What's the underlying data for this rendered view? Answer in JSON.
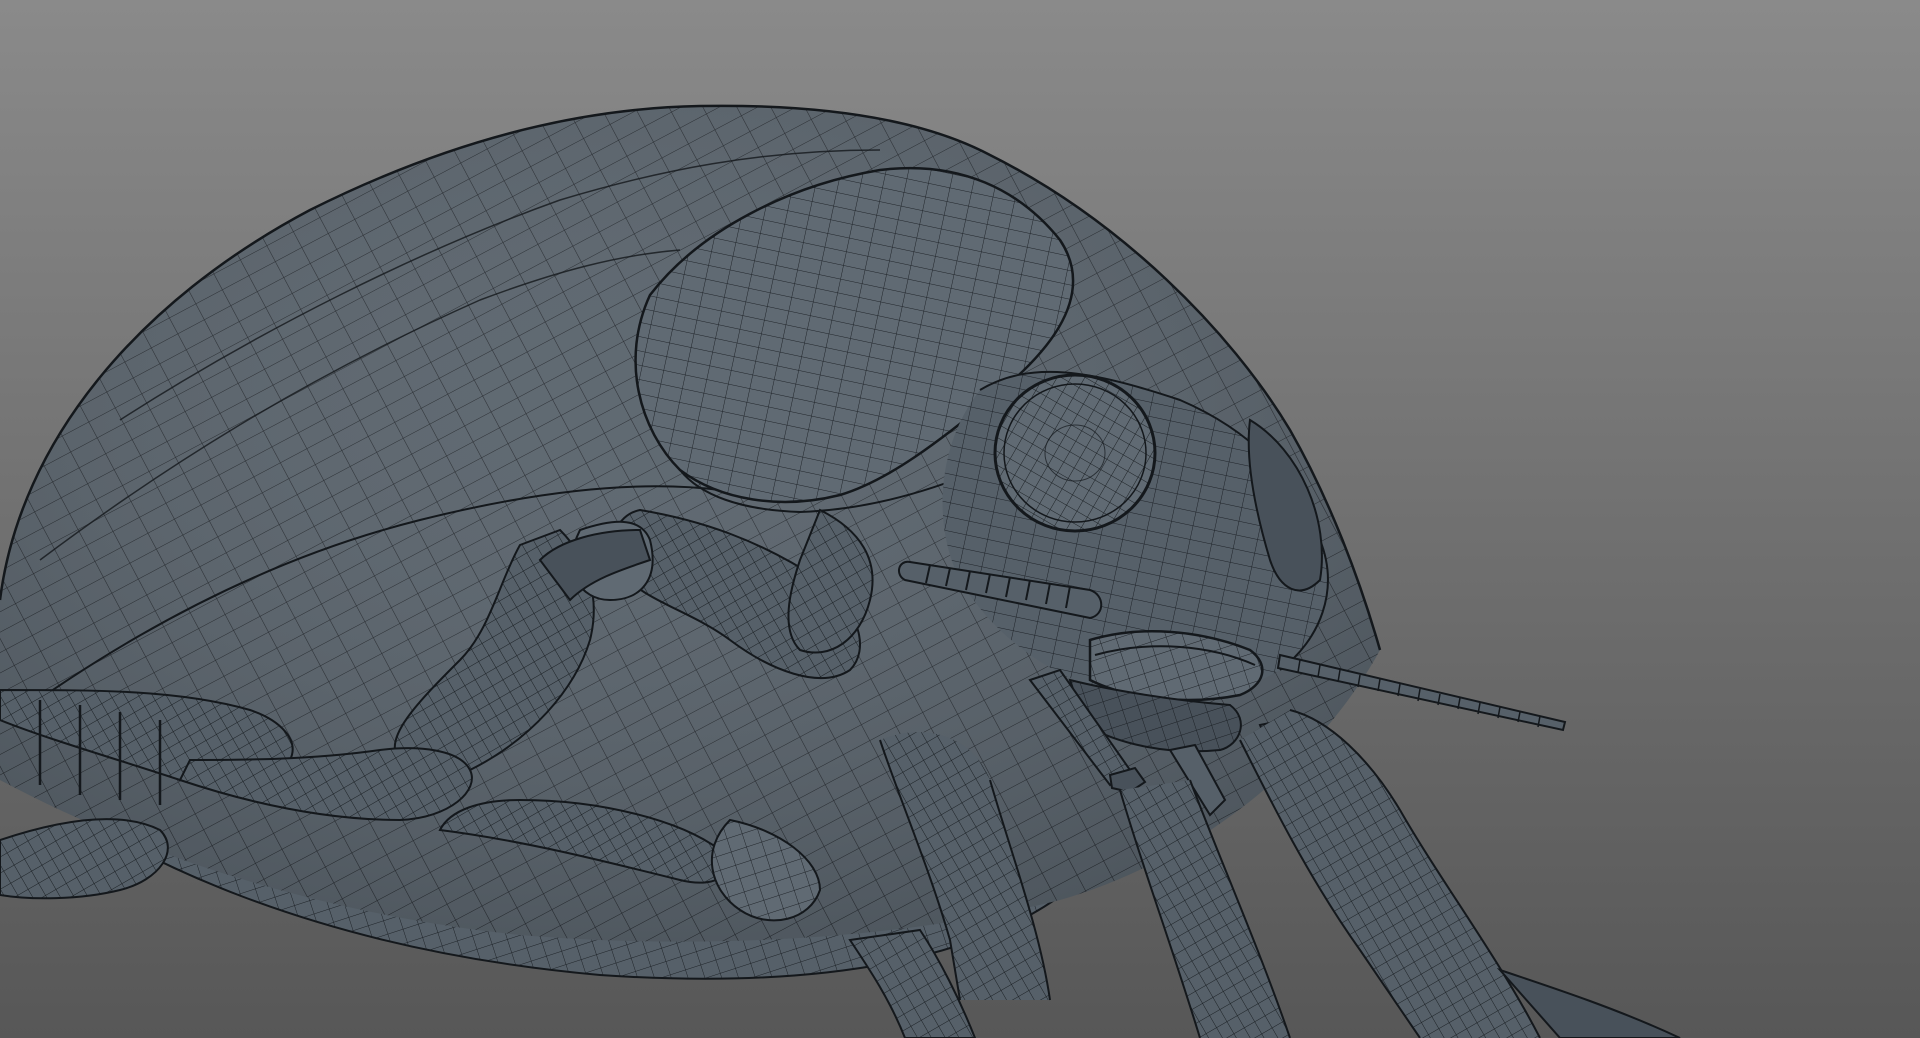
{
  "viewport": {
    "background_top": "#8a8a8a",
    "background_bottom": "#575757",
    "mesh_fill": "#566069",
    "mesh_fill_light": "#606a73",
    "mesh_fill_dark": "#48515a",
    "wire_color": "#14181c",
    "icons": [
      "mesh-object-icon"
    ]
  }
}
